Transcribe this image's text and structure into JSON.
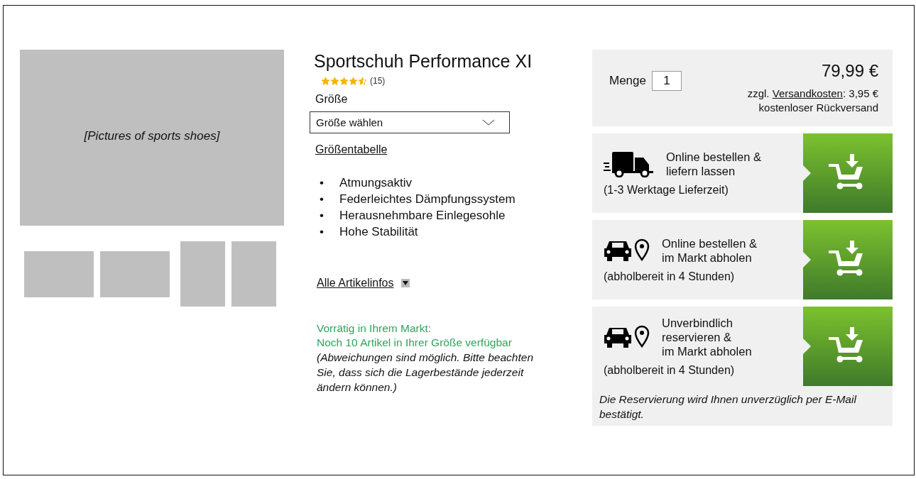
{
  "gallery": {
    "main_caption": "[Pictures of sports shoes]",
    "thumbnails": [
      {
        "kind": "landscape"
      },
      {
        "kind": "landscape"
      },
      {
        "kind": "portrait"
      },
      {
        "kind": "portrait"
      }
    ]
  },
  "product": {
    "title": "Sportschuh Performance XI",
    "rating": {
      "stars": 4.5,
      "count": "(15)"
    },
    "size_label": "Größe",
    "size_select": {
      "placeholder": "Größe wählen"
    },
    "size_chart_link": "Größentabelle",
    "features": [
      {
        "bullet": "•",
        "text": "Atmungsaktiv"
      },
      {
        "bullet": "•",
        "text": "Federleichtes Dämpfungssystem"
      },
      {
        "bullet": "•",
        "text": "Herausnehmbare Einlegesohle"
      },
      {
        "bullet": "•",
        "text": "Hohe Stabilität"
      }
    ],
    "more_info_link": "Alle Artikelinfos",
    "stock": {
      "status": "Vorrätig in Ihrem Markt:",
      "detail": "Noch 10 Artikel in Ihrer Größe verfügbar",
      "note": "(Abweichungen sind möglich. Bitte beachten Sie, dass sich die Lagerbestände jederzeit ändern können.)"
    }
  },
  "purchase": {
    "quantity_label": "Menge",
    "quantity": "1",
    "price": "79,99 €",
    "shipping_prefix": "zzgl.",
    "shipping_link": "Versandkosten",
    "shipping_suffix": ": 3,95 €",
    "returns": "kostenloser Rückversand",
    "options": [
      {
        "kind": "delivery",
        "title_lines": [
          "Online bestellen &",
          "liefern lassen"
        ],
        "detail": "(1-3 Werktage Lieferzeit)"
      },
      {
        "kind": "pickup",
        "title_lines": [
          "Online bestellen &",
          "im Markt abholen"
        ],
        "detail": "(abholbereit in 4 Stunden)"
      },
      {
        "kind": "pickup",
        "title_lines": [
          "Unverbindlich",
          "reservieren &",
          "im Markt abholen"
        ],
        "detail": "(abholbereit in 4 Stunden)"
      }
    ],
    "note": "Die Reservierung wird Ihnen unverzüglich per E-Mail bestätigt."
  }
}
